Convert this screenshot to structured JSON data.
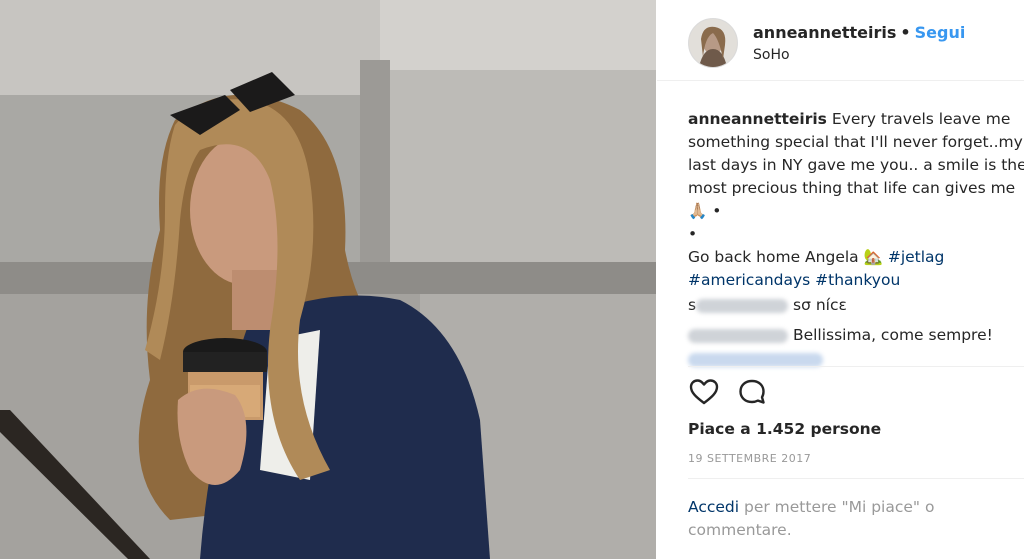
{
  "post": {
    "username": "anneannetteiris",
    "separator": "•",
    "follow_label": "Segui",
    "location": "SoHo",
    "caption": {
      "username": "anneannetteiris",
      "line1": " Every travels leave me",
      "line2": "something special that I'll never forget..my",
      "line3": "last days in NY gave me you.. a smile is the",
      "line4": "most precious thing that life can gives me",
      "emoji_pray": "🙏🏼",
      "bullet1": "•",
      "bullet2": "•",
      "line5_text": "Go back home Angela ",
      "emoji_home": "🏡",
      "hashtag1": "#jetlag",
      "hashtag2": "#americandays",
      "hashtag3": "#thankyou"
    },
    "comments": [
      {
        "user_initial": "s",
        "text": "sσ nícɛ"
      },
      {
        "text": "Bellissima, come sempre!"
      }
    ],
    "likes_text": "Piace a 1.452 persone",
    "date": "19 SETTEMBRE 2017",
    "login": {
      "link": "Accedi",
      "text": " per mettere \"Mi piace\" o commentare."
    }
  },
  "icons": [
    "heart-icon",
    "comment-icon"
  ],
  "colors": {
    "link_blue": "#3897f0",
    "hashtag_blue": "#003569",
    "muted": "#999999",
    "text": "#262626"
  }
}
